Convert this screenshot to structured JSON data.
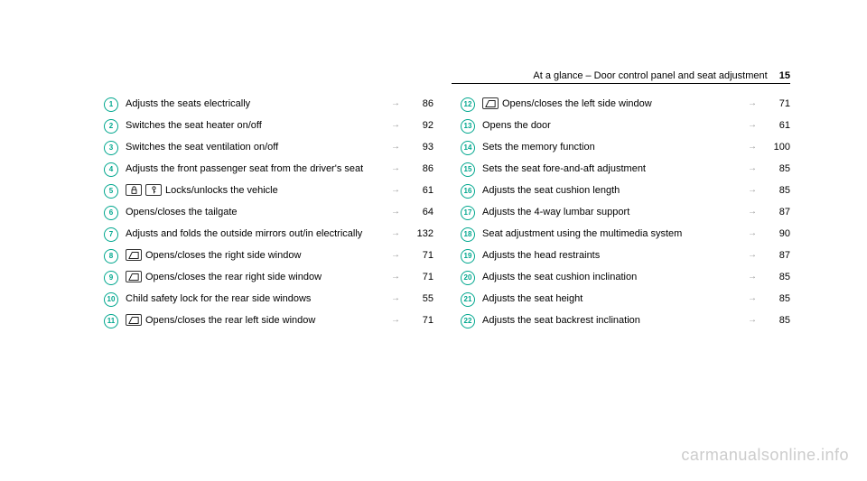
{
  "header": {
    "title": "At a glance – Door control panel and seat adjustment",
    "pagenum": "15"
  },
  "left": [
    {
      "n": "1",
      "icons": [],
      "text": "Adjusts the seats electrically",
      "page": "86"
    },
    {
      "n": "2",
      "icons": [],
      "text": "Switches the seat heater on/off",
      "page": "92"
    },
    {
      "n": "3",
      "icons": [],
      "text": "Switches the seat ventilation on/off",
      "page": "93"
    },
    {
      "n": "4",
      "icons": [],
      "text": "Adjusts the front passenger seat from the driver's seat",
      "page": "86"
    },
    {
      "n": "5",
      "icons": [
        "lock",
        "key"
      ],
      "text": "Locks/unlocks the vehicle",
      "page": "61"
    },
    {
      "n": "6",
      "icons": [],
      "text": "Opens/closes the tailgate",
      "page": "64"
    },
    {
      "n": "7",
      "icons": [],
      "text": "Adjusts and folds the outside mirrors out/in electrically",
      "page": "132"
    },
    {
      "n": "8",
      "icons": [
        "window"
      ],
      "text": "Opens/closes the right side window",
      "page": "71"
    },
    {
      "n": "9",
      "icons": [
        "window"
      ],
      "text": "Opens/closes the rear right side window",
      "page": "71"
    },
    {
      "n": "10",
      "icons": [],
      "text": "Child safety lock for the rear side windows",
      "page": "55"
    },
    {
      "n": "11",
      "icons": [
        "window"
      ],
      "text": "Opens/closes the rear left side window",
      "page": "71"
    }
  ],
  "right": [
    {
      "n": "12",
      "icons": [
        "window"
      ],
      "text": "Opens/closes the left side window",
      "page": "71"
    },
    {
      "n": "13",
      "icons": [],
      "text": "Opens the door",
      "page": "61"
    },
    {
      "n": "14",
      "icons": [],
      "text": "Sets the memory function",
      "page": "100"
    },
    {
      "n": "15",
      "icons": [],
      "text": "Sets the seat fore-and-aft adjustment",
      "page": "85"
    },
    {
      "n": "16",
      "icons": [],
      "text": "Adjusts the seat cushion length",
      "page": "85"
    },
    {
      "n": "17",
      "icons": [],
      "text": "Adjusts the 4-way lumbar support",
      "page": "87"
    },
    {
      "n": "18",
      "icons": [],
      "text": "Seat adjustment using the multimedia system",
      "page": "90"
    },
    {
      "n": "19",
      "icons": [],
      "text": "Adjusts the head restraints",
      "page": "87"
    },
    {
      "n": "20",
      "icons": [],
      "text": "Adjusts the seat cushion inclination",
      "page": "85"
    },
    {
      "n": "21",
      "icons": [],
      "text": "Adjusts the seat height",
      "page": "85"
    },
    {
      "n": "22",
      "icons": [],
      "text": "Adjusts the seat backrest inclination",
      "page": "85"
    }
  ],
  "watermark": "carmanualsonline.info",
  "arrow": "→"
}
